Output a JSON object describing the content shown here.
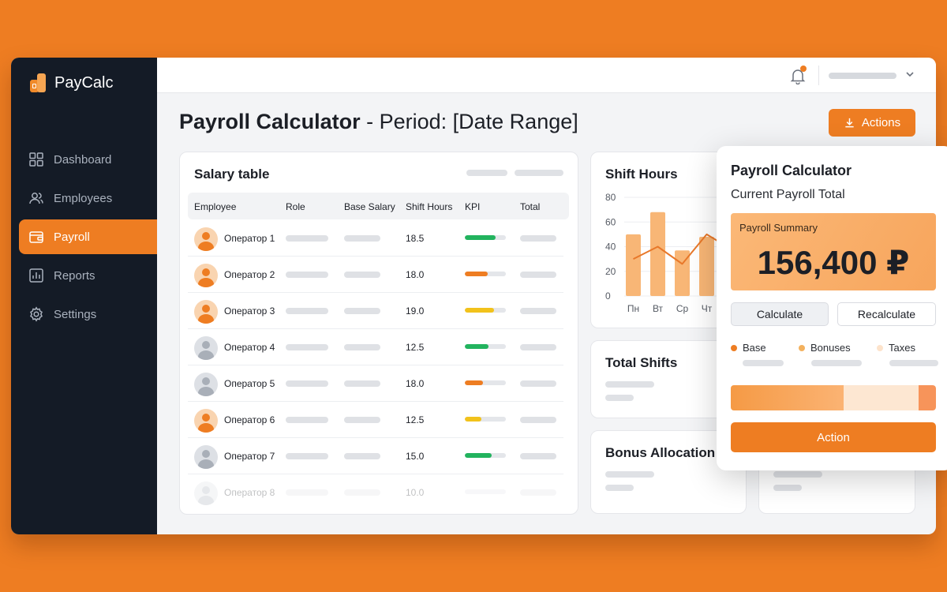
{
  "app": {
    "name": "PayCalc"
  },
  "sidebar": {
    "items": [
      {
        "label": "Dashboard",
        "icon": "grid-icon"
      },
      {
        "label": "Employees",
        "icon": "users-icon"
      },
      {
        "label": "Payroll",
        "icon": "wallet-icon",
        "active": true
      },
      {
        "label": "Reports",
        "icon": "bar-chart-icon"
      },
      {
        "label": "Settings",
        "icon": "gear-icon"
      }
    ]
  },
  "header": {
    "title_bold": "Payroll Calculator",
    "title_rest": " - Period: [Date Range]",
    "actions_label": "Actions"
  },
  "salary_table": {
    "title": "Salary table",
    "columns": [
      "Employee",
      "Role",
      "Base Salary",
      "Shift Hours",
      "KPI",
      "Total"
    ],
    "rows": [
      {
        "name": "Оператор 1",
        "hours": "18.5",
        "kpi": 0.75,
        "kpi_color": "#22b35e",
        "avatar": "orange"
      },
      {
        "name": "Оператор 2",
        "hours": "18.0",
        "kpi": 0.55,
        "kpi_color": "#ee7d22",
        "avatar": "orange"
      },
      {
        "name": "Оператор 3",
        "hours": "19.0",
        "kpi": 0.72,
        "kpi_color": "#f2c21b",
        "avatar": "orange"
      },
      {
        "name": "Оператор 4",
        "hours": "12.5",
        "kpi": 0.58,
        "kpi_color": "#22b35e",
        "avatar": "gray"
      },
      {
        "name": "Оператор 5",
        "hours": "18.0",
        "kpi": 0.45,
        "kpi_color": "#ee7d22",
        "avatar": "gray"
      },
      {
        "name": "Оператор 6",
        "hours": "12.5",
        "kpi": 0.4,
        "kpi_color": "#f2c21b",
        "avatar": "orange"
      },
      {
        "name": "Оператор 7",
        "hours": "15.0",
        "kpi": 0.65,
        "kpi_color": "#22b35e",
        "avatar": "gray"
      },
      {
        "name": "Оператор 8",
        "hours": "10.0",
        "kpi": 0.0,
        "kpi_color": "#e4e6ea",
        "avatar": "gray"
      }
    ]
  },
  "shift_hours": {
    "title": "Shift Hours"
  },
  "chart_data": {
    "type": "bar",
    "title": "Shift Hours",
    "categories": [
      "Пн",
      "Вт",
      "Ср",
      "Чт"
    ],
    "values": [
      50,
      68,
      37,
      48
    ],
    "line_values": [
      30,
      40,
      26,
      50,
      38
    ],
    "ylim": [
      0,
      80
    ],
    "yticks": [
      0,
      20,
      40,
      60,
      80
    ],
    "bar_color": "#f8b676",
    "line_color": "#e8782a",
    "grid": true
  },
  "total_shifts": {
    "title": "Total Shifts"
  },
  "bonus_allocation": {
    "title": "Bonus Allocation"
  },
  "calculator": {
    "title": "Payroll Calculator",
    "subtitle": "Current Payroll Total",
    "summary_label": "Payroll Summary",
    "summary_value": "156,400 ₽",
    "calculate_label": "Calculate",
    "recalculate_label": "Recalculate",
    "legend": [
      {
        "label": "Base",
        "color": "#ee7d22"
      },
      {
        "label": "Bonuses",
        "color": "#f3b15e"
      },
      {
        "label": "Taxes",
        "color": "#fde3cb"
      }
    ],
    "progress": 0.55,
    "action_label": "Action"
  },
  "colors": {
    "accent": "#ee7d22",
    "sidebar": "#141b26"
  }
}
